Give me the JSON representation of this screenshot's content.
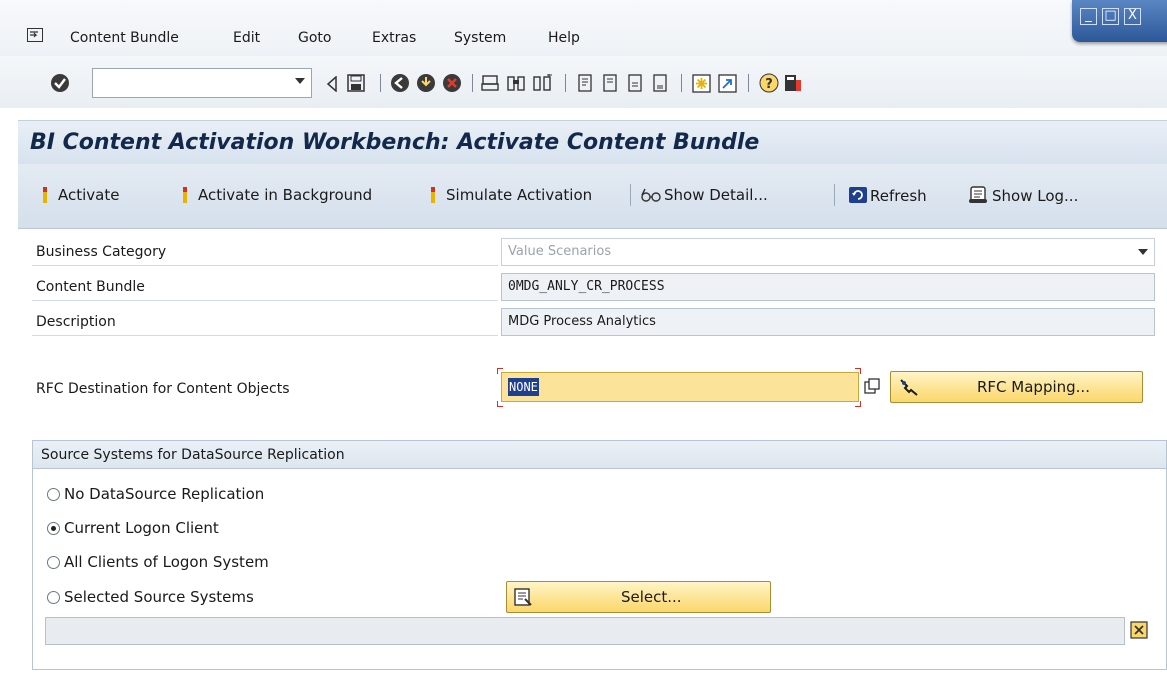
{
  "menu": {
    "items": [
      "Content Bundle",
      "Edit",
      "Goto",
      "Extras",
      "System",
      "Help"
    ]
  },
  "window_controls": [
    "_",
    "□",
    "X"
  ],
  "command_field": {
    "value": ""
  },
  "title": "BI Content Activation Workbench: Activate Content Bundle",
  "app_toolbar": {
    "activate": "Activate",
    "activate_background": "Activate in Background",
    "simulate": "Simulate Activation",
    "show_detail": "Show Detail...",
    "refresh": "Refresh",
    "show_log": "Show Log..."
  },
  "form": {
    "business_category": {
      "label": "Business Category",
      "value": "Value Scenarios"
    },
    "content_bundle": {
      "label": "Content Bundle",
      "value": "0MDG_ANLY_CR_PROCESS"
    },
    "description": {
      "label": "Description",
      "value": "MDG Process Analytics"
    },
    "rfc_destination": {
      "label": "RFC Destination for Content Objects",
      "value": "NONE"
    },
    "rfc_mapping_button": "RFC Mapping..."
  },
  "source_systems": {
    "heading": "Source Systems for DataSource Replication",
    "options": [
      {
        "label": "No DataSource Replication",
        "selected": false
      },
      {
        "label": "Current Logon Client",
        "selected": true
      },
      {
        "label": "All Clients of Logon System",
        "selected": false
      },
      {
        "label": "Selected Source Systems",
        "selected": false
      }
    ],
    "select_button": "Select...",
    "selected_systems_value": ""
  },
  "colors": {
    "title_text": "#13294b",
    "required_field": "#fbe49a",
    "button_yellow": "#fbd76a",
    "activate_icon": "#e8b400"
  }
}
